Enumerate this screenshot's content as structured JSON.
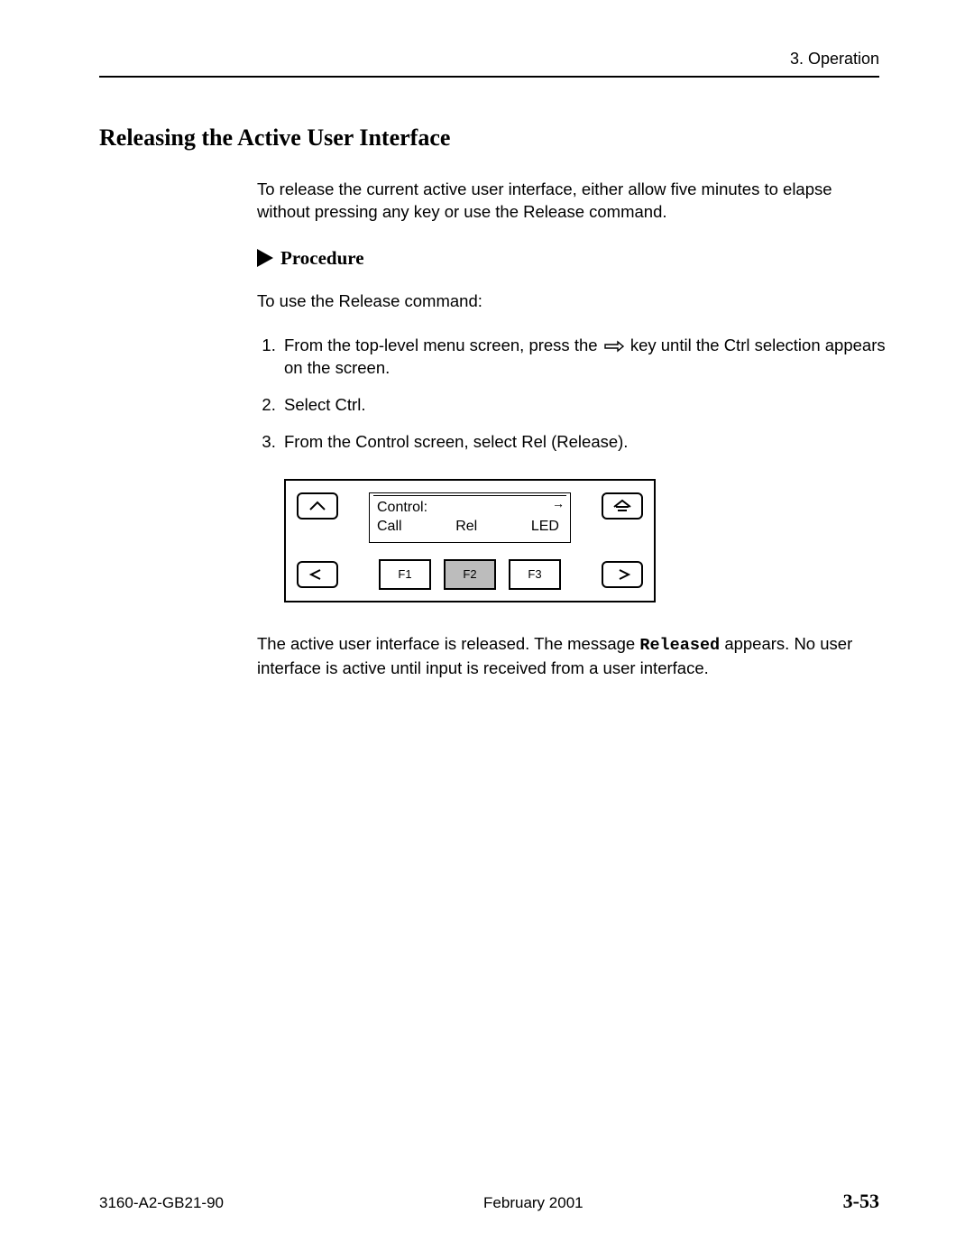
{
  "header": {
    "running": "3. Operation"
  },
  "section": {
    "title": "Releasing the Active User Interface",
    "intro": "To release the current active user interface, either allow five minutes to elapse without pressing any key or use the Release command.",
    "procedure_label": "Procedure",
    "procedure_intro": "To use the Release command:",
    "steps": {
      "s1a": "From the top-level menu screen, press the ",
      "s1b": " key until the Ctrl selection appears on the screen.",
      "s2": "Select Ctrl.",
      "s3": "From the Control screen, select Rel (Release)."
    },
    "result_a": "The active user interface is released. The message ",
    "result_code": "Released",
    "result_b": " appears. No user interface is active until input is received from a user interface."
  },
  "panel": {
    "lcd_line1": "Control:",
    "lcd_opts": {
      "a": "Call",
      "b": "Rel",
      "c": "LED"
    },
    "fkeys": {
      "f1": "F1",
      "f2": "F2",
      "f3": "F3"
    }
  },
  "footer": {
    "docnum": "3160-A2-GB21-90",
    "date": "February 2001",
    "page": "3-53"
  }
}
